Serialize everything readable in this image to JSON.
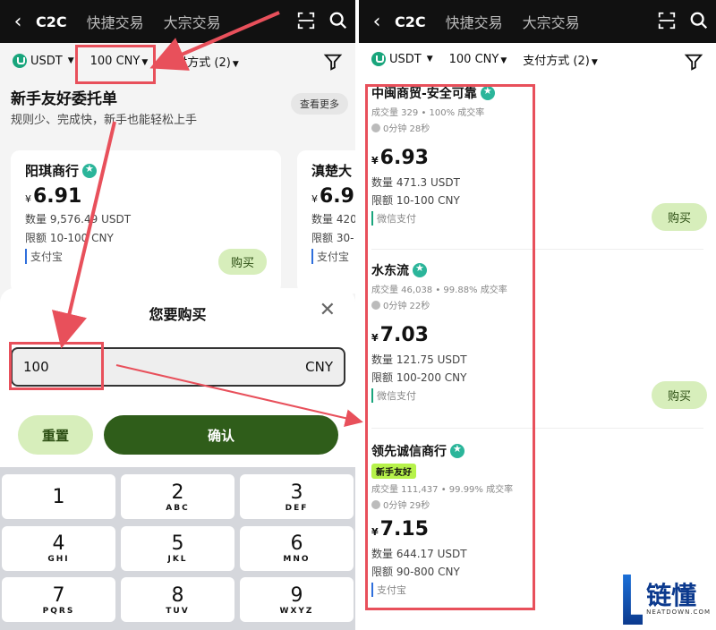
{
  "left": {
    "nav": {
      "back": "‹",
      "tabs": [
        "C2C",
        "快捷交易",
        "大宗交易"
      ]
    },
    "filter": {
      "coin": "USDT",
      "amount": "100 CNY",
      "payment": "支付方式 (2)"
    },
    "promo": {
      "title": "新手友好委托单",
      "subtitle": "规则少、完成快，新手也能轻松上手",
      "more": "查看更多"
    },
    "cards": [
      {
        "name": "阳琪商行",
        "currency": "¥",
        "price": "6.91",
        "qty": "数量 9,576.49 USDT",
        "limit": "限额 10-100 CNY",
        "pay": "支付宝",
        "buy": "购买"
      },
      {
        "name": "滇楚大",
        "currency": "¥",
        "price": "6.9",
        "qty": "数量 420",
        "limit": "限额 30-",
        "pay": "支付宝"
      }
    ],
    "sheet": {
      "title": "您要购买",
      "close": "✕",
      "amount_value": "100",
      "amount_unit": "CNY",
      "reset": "重置",
      "confirm": "确认",
      "keys": [
        {
          "n": "1",
          "l": ""
        },
        {
          "n": "2",
          "l": "ABC"
        },
        {
          "n": "3",
          "l": "DEF"
        },
        {
          "n": "4",
          "l": "GHI"
        },
        {
          "n": "5",
          "l": "JKL"
        },
        {
          "n": "6",
          "l": "MNO"
        },
        {
          "n": "7",
          "l": "PQRS"
        },
        {
          "n": "8",
          "l": "TUV"
        },
        {
          "n": "9",
          "l": "WXYZ"
        }
      ]
    }
  },
  "right": {
    "nav": {
      "back": "‹",
      "tabs": [
        "C2C",
        "快捷交易",
        "大宗交易"
      ]
    },
    "filter": {
      "coin": "USDT",
      "amount": "100 CNY",
      "payment": "支付方式 (2)"
    },
    "listings": [
      {
        "name": "中闽商贸-安全可靠",
        "stats": "成交量 329 • 100% 成交率",
        "time": "0分钟 28秒",
        "currency": "¥",
        "price": "6.93",
        "qty": "数量 471.3 USDT",
        "limit": "限额 10-100 CNY",
        "pay": "微信支付",
        "buy": "购买"
      },
      {
        "name": "水东流",
        "stats": "成交量 46,038 • 99.88% 成交率",
        "time": "0分钟 22秒",
        "currency": "¥",
        "price": "7.03",
        "qty": "数量 121.75 USDT",
        "limit": "限额 100-200 CNY",
        "pay": "微信支付",
        "buy": "购买"
      },
      {
        "name": "领先诚信商行",
        "tag": "新手友好",
        "stats": "成交量 111,437 • 99.99% 成交率",
        "time": "0分钟 29秒",
        "currency": "¥",
        "price": "7.15",
        "qty": "数量 644.17 USDT",
        "limit": "限额 90-800 CNY",
        "pay": "支付宝"
      }
    ]
  },
  "watermark": {
    "text": "链懂",
    "sub": "NEATDOWN.COM"
  },
  "colors": {
    "accent": "#2f5d1a",
    "highlight": "#e8505b",
    "buy_bg": "#d7eebb"
  }
}
